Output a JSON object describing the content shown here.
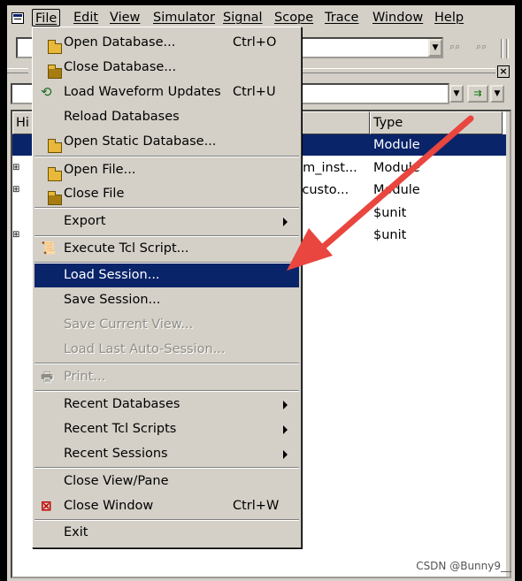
{
  "menubar": {
    "items": [
      "File",
      "Edit",
      "View",
      "Simulator",
      "Signal",
      "Scope",
      "Trace",
      "Window",
      "Help"
    ]
  },
  "tree": {
    "headers": [
      "Hi",
      "Type"
    ],
    "rows": [
      {
        "instance": "",
        "type": "Module",
        "selected": true
      },
      {
        "instance": "stom_inst...",
        "type": "Module",
        "selected": false
      },
      {
        "instance": "m_custo...",
        "type": "Module",
        "selected": false
      },
      {
        "instance": "",
        "type": "$unit",
        "selected": false
      },
      {
        "instance": "",
        "type": "$unit",
        "selected": false
      }
    ]
  },
  "file_menu": {
    "open_database": {
      "label": "Open Database...",
      "shortcut": "Ctrl+O"
    },
    "close_database": {
      "label": "Close Database..."
    },
    "load_waveform_updates": {
      "label": "Load Waveform Updates",
      "shortcut": "Ctrl+U"
    },
    "reload_databases": {
      "label": "Reload Databases"
    },
    "open_static_database": {
      "label": "Open Static Database..."
    },
    "open_file": {
      "label": "Open File..."
    },
    "close_file": {
      "label": "Close File"
    },
    "export": {
      "label": "Export"
    },
    "execute_tcl_script": {
      "label": "Execute Tcl Script..."
    },
    "load_session": {
      "label": "Load Session..."
    },
    "save_session": {
      "label": "Save Session..."
    },
    "save_current_view": {
      "label": "Save Current View..."
    },
    "load_last_auto_session": {
      "label": "Load Last Auto-Session..."
    },
    "print": {
      "label": "Print..."
    },
    "recent_databases": {
      "label": "Recent Databases"
    },
    "recent_tcl_scripts": {
      "label": "Recent Tcl Scripts"
    },
    "recent_sessions": {
      "label": "Recent Sessions"
    },
    "close_view_pane": {
      "label": "Close View/Pane"
    },
    "close_window": {
      "label": "Close Window",
      "shortcut": "Ctrl+W"
    },
    "exit": {
      "label": "Exit"
    }
  },
  "watermark": "CSDN @Bunny9__",
  "colors": {
    "highlight": "#0a246a",
    "annotation_arrow": "#e8463f",
    "chrome": "#d4d0c8"
  }
}
